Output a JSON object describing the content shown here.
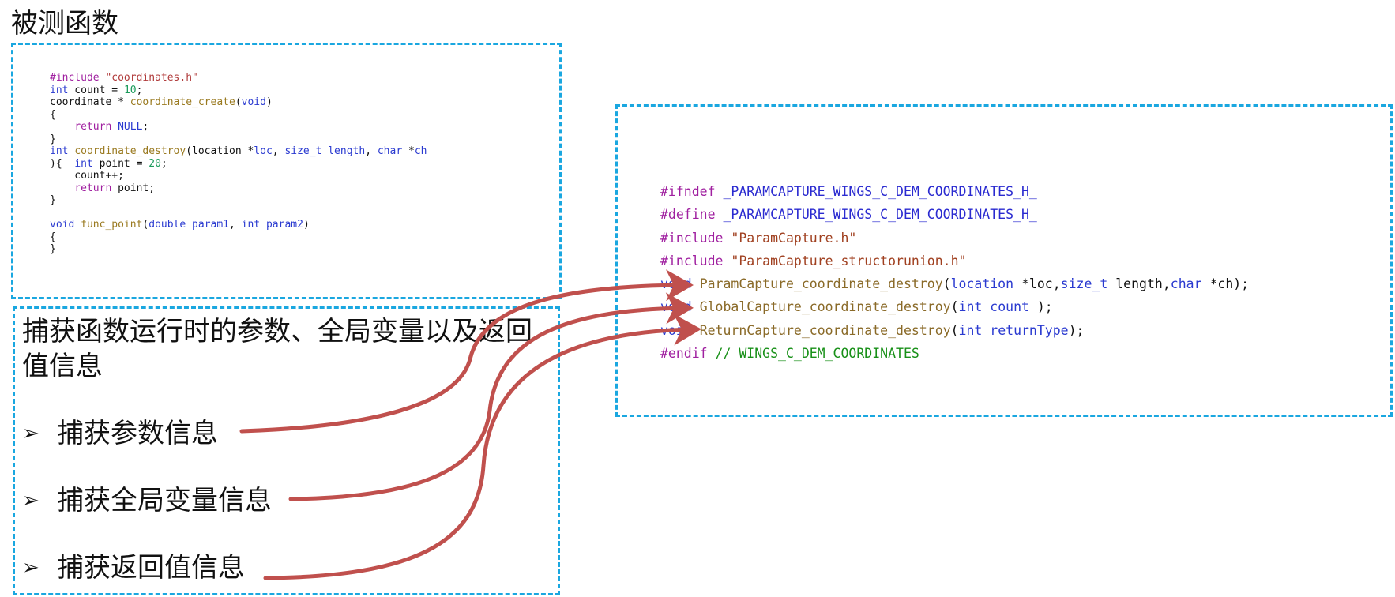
{
  "title": "被测函数",
  "source_code": {
    "lines": [
      [
        [
          "#include ",
          "pp"
        ],
        [
          "\"coordinates.h\"",
          "str"
        ]
      ],
      [
        [
          "int",
          "kw"
        ],
        [
          " count = ",
          "var"
        ],
        [
          "10",
          "num"
        ],
        [
          ";",
          "var"
        ]
      ],
      [
        [
          "coordinate * ",
          "var"
        ],
        [
          "coordinate_create",
          "fn"
        ],
        [
          "(",
          "var"
        ],
        [
          "void",
          "kw"
        ],
        [
          ")",
          "var"
        ]
      ],
      [
        [
          "{",
          "var"
        ]
      ],
      [
        [
          "    ",
          "var"
        ],
        [
          "return",
          "pp"
        ],
        [
          " ",
          "var"
        ],
        [
          "NULL",
          "kw"
        ],
        [
          ";",
          "var"
        ]
      ],
      [
        [
          "}",
          "var"
        ]
      ],
      [
        [
          "int",
          "kw"
        ],
        [
          " ",
          "var"
        ],
        [
          "coordinate_destroy",
          "fn"
        ],
        [
          "(location *",
          "var"
        ],
        [
          "loc",
          "kw"
        ],
        [
          ", ",
          "var"
        ],
        [
          "size_t",
          "kw"
        ],
        [
          " ",
          "var"
        ],
        [
          "length",
          "kw"
        ],
        [
          ", ",
          "var"
        ],
        [
          "char",
          "kw"
        ],
        [
          " *",
          "var"
        ],
        [
          "ch",
          "kw"
        ]
      ],
      [
        [
          "){  ",
          "var"
        ],
        [
          "int",
          "kw"
        ],
        [
          " point = ",
          "var"
        ],
        [
          "20",
          "num"
        ],
        [
          ";",
          "var"
        ]
      ],
      [
        [
          "    count++;",
          "var"
        ]
      ],
      [
        [
          "    ",
          "var"
        ],
        [
          "return",
          "pp"
        ],
        [
          " point;",
          "var"
        ]
      ],
      [
        [
          "}",
          "var"
        ]
      ],
      [
        [
          "",
          "var"
        ]
      ],
      [
        [
          "void",
          "kw"
        ],
        [
          " ",
          "var"
        ],
        [
          "func_point",
          "fn"
        ],
        [
          "(",
          "var"
        ],
        [
          "double",
          "kw"
        ],
        [
          " ",
          "var"
        ],
        [
          "param1",
          "kw"
        ],
        [
          ", ",
          "var"
        ],
        [
          "int",
          "kw"
        ],
        [
          " ",
          "var"
        ],
        [
          "param2",
          "kw"
        ],
        [
          ")",
          "var"
        ]
      ],
      [
        [
          "{",
          "var"
        ]
      ],
      [
        [
          "}",
          "var"
        ]
      ]
    ]
  },
  "header_code": {
    "lines": [
      [
        [
          "#ifndef",
          "pp"
        ],
        [
          " _PARAMCAPTURE_WINGS_C_DEM_COORDINATES_H_",
          "hmacro"
        ]
      ],
      [
        [
          "#define",
          "pp"
        ],
        [
          " _PARAMCAPTURE_WINGS_C_DEM_COORDINATES_H_",
          "hmacro"
        ]
      ],
      [
        [
          "#include",
          "pp"
        ],
        [
          " ",
          "var"
        ],
        [
          "\"ParamCapture.h\"",
          "hstr"
        ]
      ],
      [
        [
          "#include",
          "pp"
        ],
        [
          " ",
          "var"
        ],
        [
          "\"ParamCapture_structorunion.h\"",
          "hstr"
        ]
      ],
      [
        [
          "void",
          "htype"
        ],
        [
          " ",
          "var"
        ],
        [
          "ParamCapture_coordinate_destroy",
          "hfn"
        ],
        [
          "(",
          "var"
        ],
        [
          "location",
          "htype"
        ],
        [
          " *loc,",
          "var"
        ],
        [
          "size_t",
          "htype"
        ],
        [
          " length,",
          "var"
        ],
        [
          "char",
          "htype"
        ],
        [
          " *ch);",
          "var"
        ]
      ],
      [
        [
          "void",
          "htype"
        ],
        [
          " ",
          "var"
        ],
        [
          "GlobalCapture_coordinate_destroy",
          "hfn"
        ],
        [
          "(",
          "var"
        ],
        [
          "int",
          "htype"
        ],
        [
          " ",
          "var"
        ],
        [
          "count",
          "hparam"
        ],
        [
          " );",
          "var"
        ]
      ],
      [
        [
          "void",
          "htype"
        ],
        [
          " ",
          "var"
        ],
        [
          "ReturnCapture_coordinate_destroy",
          "hfn"
        ],
        [
          "(",
          "var"
        ],
        [
          "int",
          "htype"
        ],
        [
          " ",
          "var"
        ],
        [
          "returnType",
          "hparam"
        ],
        [
          ");",
          "var"
        ]
      ],
      [
        [
          "#endif",
          "pp"
        ],
        [
          " // WINGS_C_DEM_COORDINATES",
          "hcomment"
        ]
      ]
    ]
  },
  "capture": {
    "heading": "捕获函数运行时的参数、全局变量以及返回值信息",
    "bullet_symbol": "➢",
    "bullets": [
      "捕获参数信息",
      "捕获全局变量信息",
      "捕获返回值信息"
    ]
  },
  "colors": {
    "dashed_border": "#1aa7e0",
    "arrow": "#c0504d"
  }
}
